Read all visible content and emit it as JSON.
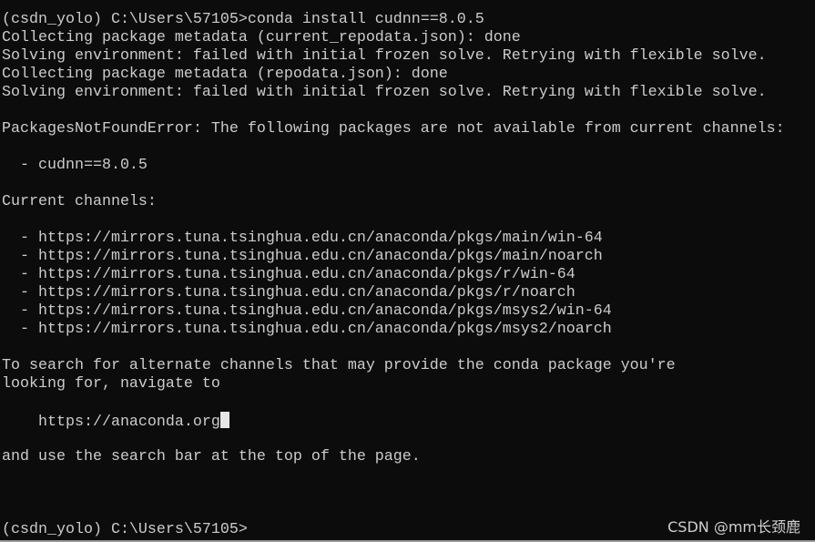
{
  "terminal": {
    "lines": [
      "(csdn_yolo) C:\\Users\\57105>conda install cudnn==8.0.5",
      "Collecting package metadata (current_repodata.json): done",
      "Solving environment: failed with initial frozen solve. Retrying with flexible solve.",
      "Collecting package metadata (repodata.json): done",
      "Solving environment: failed with initial frozen solve. Retrying with flexible solve.",
      "",
      "PackagesNotFoundError: The following packages are not available from current channels:",
      "",
      "  - cudnn==8.0.5",
      "",
      "Current channels:",
      "",
      "  - https://mirrors.tuna.tsinghua.edu.cn/anaconda/pkgs/main/win-64",
      "  - https://mirrors.tuna.tsinghua.edu.cn/anaconda/pkgs/main/noarch",
      "  - https://mirrors.tuna.tsinghua.edu.cn/anaconda/pkgs/r/win-64",
      "  - https://mirrors.tuna.tsinghua.edu.cn/anaconda/pkgs/r/noarch",
      "  - https://mirrors.tuna.tsinghua.edu.cn/anaconda/pkgs/msys2/win-64",
      "  - https://mirrors.tuna.tsinghua.edu.cn/anaconda/pkgs/msys2/noarch",
      "",
      "To search for alternate channels that may provide the conda package you're",
      "looking for, navigate to",
      "",
      "    https://anaconda.org",
      "",
      "and use the search bar at the top of the page.",
      "",
      "",
      "",
      "(csdn_yolo) C:\\Users\\57105>"
    ],
    "cursor_line": 22
  },
  "watermark": "CSDN @mm长颈鹿",
  "colors": {
    "background": "#0c0c0c",
    "foreground": "#cccccc"
  }
}
